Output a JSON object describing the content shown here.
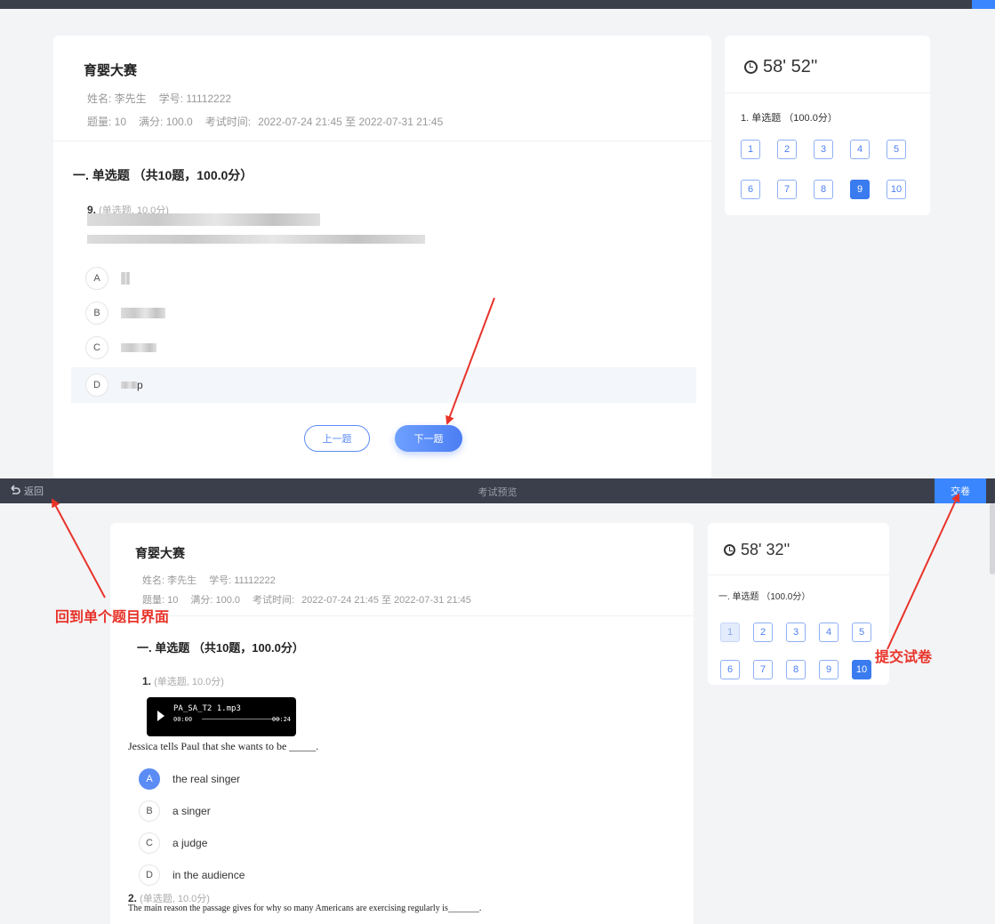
{
  "top": {
    "exam_title": "育婴大赛",
    "name_label": "姓名: 李先生",
    "id_label": "学号: 11112222",
    "count_label": "题量: 10",
    "score_label": "满分: 100.0",
    "time_label": "考试时间:",
    "time_range": "2022-07-24 21:45  至  2022-07-31 21:45",
    "section_title": "一. 单选题 （共10题，100.0分）",
    "question_num": "9.",
    "question_meta": "(单选题, 10.0分)",
    "options": [
      {
        "letter": "A"
      },
      {
        "letter": "B"
      },
      {
        "letter": "C"
      },
      {
        "letter": "D",
        "text": "p"
      }
    ],
    "prev_label": "上一题",
    "next_label": "下一题",
    "timer": "58' 52''",
    "nav_section": "1. 单选题 （100.0分）",
    "nav_numbers": [
      "1",
      "2",
      "3",
      "4",
      "5",
      "6",
      "7",
      "8",
      "9",
      "10"
    ],
    "nav_current": "9"
  },
  "toolbar": {
    "back_label": "返回",
    "title": "考试预览",
    "submit_label": "交卷"
  },
  "bottom": {
    "exam_title": "育婴大赛",
    "name_label": "姓名: 李先生",
    "id_label": "学号: 11112222",
    "count_label": "题量: 10",
    "score_label": "满分: 100.0",
    "time_label": "考试时间:",
    "time_range": "2022-07-24 21:45  至  2022-07-31 21:45",
    "section_title": "一. 单选题 （共10题，100.0分）",
    "q1_num": "1.",
    "q1_meta": "(单选题, 10.0分)",
    "audio_name": "PA_SA_T2 1.mp3",
    "audio_start": "00:00",
    "audio_end": "00:24",
    "q1_text": "Jessica tells Paul that she wants to be _____.",
    "options": [
      {
        "letter": "A",
        "text": "the real singer",
        "selected": true
      },
      {
        "letter": "B",
        "text": "a singer"
      },
      {
        "letter": "C",
        "text": "a judge"
      },
      {
        "letter": "D",
        "text": "in the audience"
      }
    ],
    "q2_num": "2.",
    "q2_meta": "(单选题, 10.0分)",
    "q2_text": "The main reason the passage gives for why so many Americans are exercising regularly is_______.",
    "timer": "58' 32''",
    "nav_section": "一. 单选题 （100.0分）",
    "nav_numbers": [
      "1",
      "2",
      "3",
      "4",
      "5",
      "6",
      "7",
      "8",
      "9",
      "10"
    ],
    "nav_current": "10",
    "nav_done": "1"
  },
  "annotations": {
    "back_note": "回到单个题目界面",
    "submit_note": "提交试卷"
  },
  "colors": {
    "accent": "#3a86ff",
    "toolbar": "#3b3f4c",
    "annotation": "#e8332a"
  }
}
